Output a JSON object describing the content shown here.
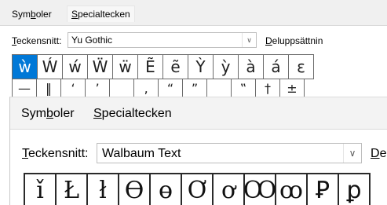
{
  "small_dialog": {
    "tabs": [
      {
        "label": "Symboler",
        "mnemonic": "b"
      },
      {
        "label": "Specialtecken",
        "mnemonic": "S"
      }
    ],
    "font_label": "Teckensnitt:",
    "font_value": "Yu Gothic",
    "subset_label": "Deluppsättnin",
    "symbols_row1": [
      "ẁ",
      "Ẃ",
      "ẃ",
      "Ẅ",
      "ẅ",
      "Ẽ",
      "ẽ",
      "Ỳ",
      "ỳ",
      "à",
      "á",
      "ε"
    ],
    "symbols_row2": [
      "—",
      "‖",
      "‘",
      "’",
      "",
      "‚",
      "“",
      "”",
      "",
      "‟",
      "†",
      "±"
    ],
    "selected_index": 0
  },
  "large_dialog": {
    "tabs": [
      {
        "label": "Symboler",
        "mnemonic": "b"
      },
      {
        "label": "Specialtecken",
        "mnemonic": "S"
      }
    ],
    "font_label": "Teckensnitt:",
    "font_value": "Walbaum Text",
    "subset_label": "De",
    "symbols": [
      "ǐ",
      "Ł",
      "ł",
      "Ө",
      "ө",
      "Ơ",
      "ơ",
      "Ꝏ",
      "ꝏ",
      "Ꝑ",
      "ꝑ"
    ]
  },
  "icons": {
    "dropdown": "chevron-down-icon"
  },
  "colors": {
    "selection": "#0078d7",
    "tab_bar": "#f0f0f0"
  }
}
